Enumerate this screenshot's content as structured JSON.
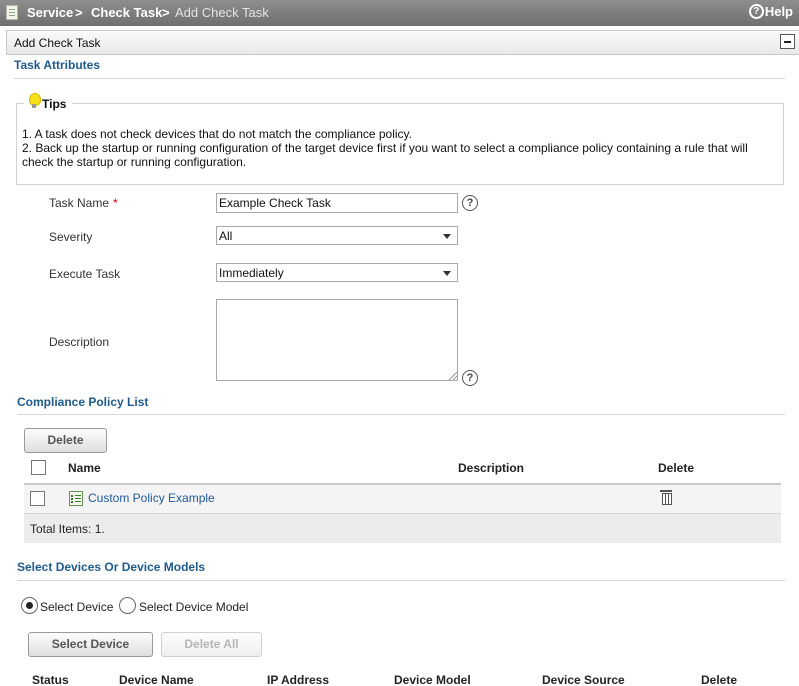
{
  "breadcrumb": {
    "items": [
      "Service",
      "Check Task"
    ],
    "current": "Add Check Task",
    "separator": ">"
  },
  "help": {
    "label": "Help",
    "icon": "?"
  },
  "panel": {
    "title": "Add Check Task"
  },
  "task_attributes": {
    "title": "Task Attributes",
    "tips": {
      "label": "Tips",
      "lines": [
        "1. A task does not check devices that do not match the compliance policy.",
        "2. Back up the startup or running configuration of the target device first if you want to select a compliance policy containing a rule that will check the startup or running configuration."
      ]
    }
  },
  "form": {
    "task_name": {
      "label": "Task Name",
      "required_mark": "*",
      "value": "Example Check Task"
    },
    "severity": {
      "label": "Severity",
      "value": "All"
    },
    "execute_task": {
      "label": "Execute Task",
      "value": "Immediately"
    },
    "description": {
      "label": "Description",
      "value": ""
    },
    "help_glyph": "?"
  },
  "compliance_policy": {
    "title": "Compliance Policy List",
    "delete_button": "Delete",
    "columns": {
      "name": "Name",
      "description": "Description",
      "delete": "Delete"
    },
    "rows": [
      {
        "name": "Custom Policy Example",
        "description": ""
      }
    ],
    "total": "Total Items: 1."
  },
  "devices": {
    "title": "Select Devices Or Device Models",
    "radio_device": "Select Device",
    "radio_model": "Select Device Model",
    "selected_mode": "Select Device",
    "select_button": "Select Device",
    "delete_all_button": "Delete All",
    "columns": {
      "status": "Status",
      "device_name": "Device Name",
      "ip_address": "IP Address",
      "device_model": "Device Model",
      "device_source": "Device Source",
      "delete": "Delete"
    }
  },
  "colors": {
    "section_title": "#1f5a8c",
    "link": "#1f5a9c",
    "required": "#d00000",
    "topbar": "#7a7a7a"
  }
}
